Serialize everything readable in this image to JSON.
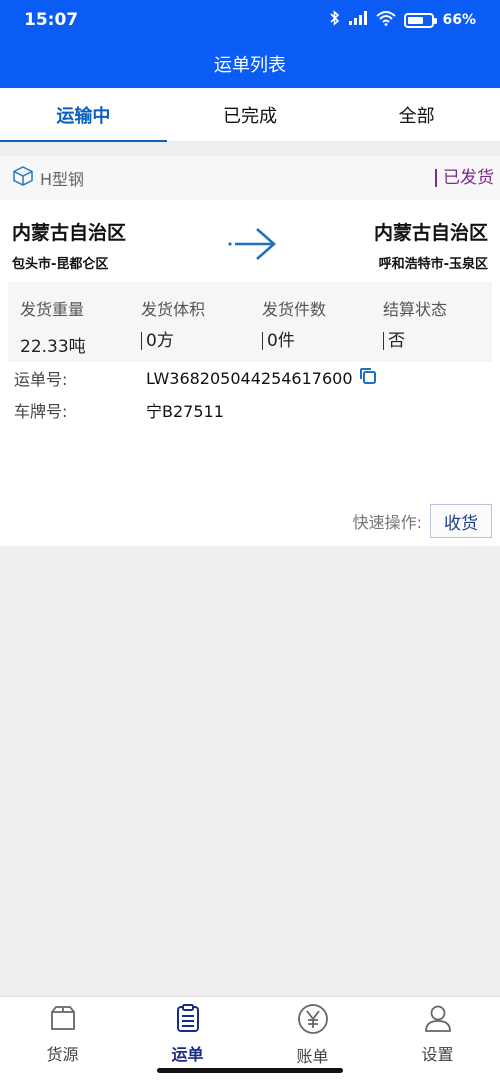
{
  "status_bar": {
    "time": "15:07",
    "battery": "66%",
    "battery_level": 0.66
  },
  "header": {
    "title": "运单列表"
  },
  "tabs": [
    {
      "label": "运输中",
      "active": true
    },
    {
      "label": "已完成",
      "active": false
    },
    {
      "label": "全部",
      "active": false
    }
  ],
  "order": {
    "goods": "H型钢",
    "status": "已发货",
    "from": {
      "province": "内蒙古自治区",
      "city": "包头市-昆都仑区"
    },
    "to": {
      "province": "内蒙古自治区",
      "city": "呼和浩特市-玉泉区"
    },
    "stats": [
      {
        "label": "发货重量",
        "value": "22.33吨"
      },
      {
        "label": "发货体积",
        "value": "0方"
      },
      {
        "label": "发货件数",
        "value": "0件"
      },
      {
        "label": "结算状态",
        "value": "否"
      }
    ],
    "waybill_label": "运单号:",
    "waybill_no": "LW368205044254617600",
    "plate_label": "车牌号:",
    "plate_no": "宁B27511",
    "quick_label": "快速操作:",
    "receive_label": "收货"
  },
  "bottom_nav": [
    {
      "label": "货源",
      "icon": "box-icon"
    },
    {
      "label": "运单",
      "icon": "clipboard-icon",
      "active": true
    },
    {
      "label": "账单",
      "icon": "yen-icon"
    },
    {
      "label": "设置",
      "icon": "user-icon"
    }
  ],
  "colors": {
    "primary": "#0a5cf5",
    "tab_active": "#0d5fbf",
    "status": "#7b2b8c"
  }
}
